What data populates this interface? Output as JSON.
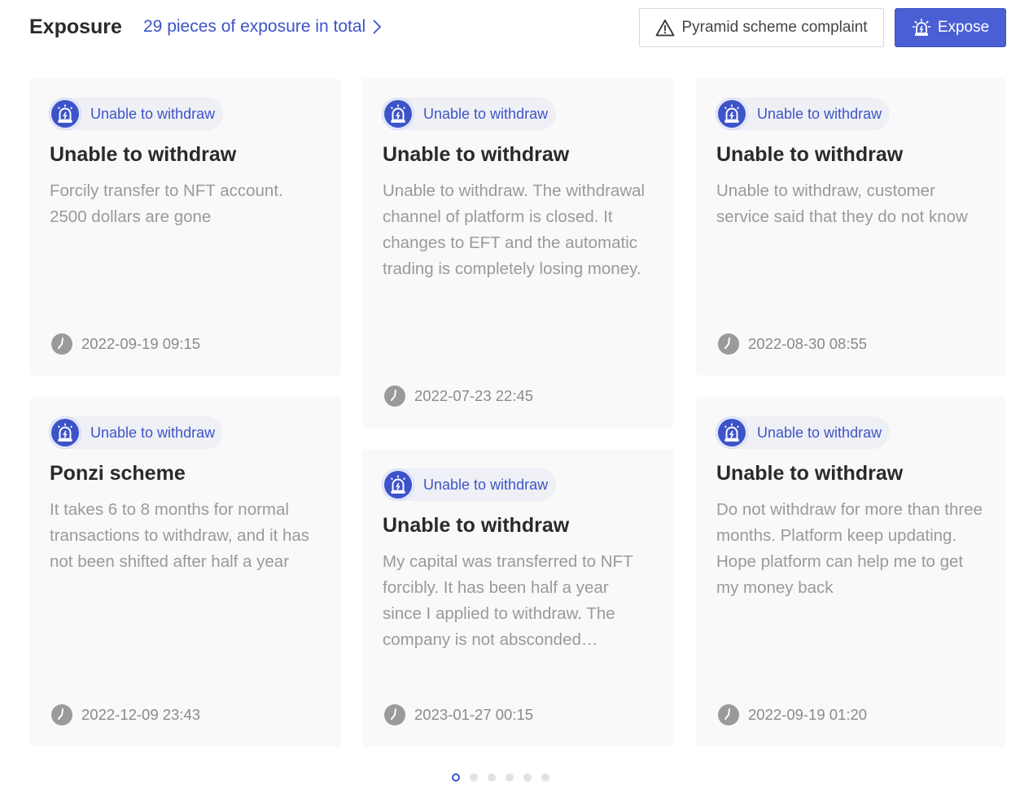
{
  "header": {
    "title": "Exposure",
    "total_link": "29 pieces of exposure in total",
    "complaint_button": "Pyramid scheme complaint",
    "expose_button": "Expose"
  },
  "colors": {
    "accent": "#4a5fd4",
    "link": "#3d54c8",
    "tag_bg": "#eff0f6",
    "card_bg": "#f9f9f9"
  },
  "cards": [
    {
      "tag": "Unable to withdraw",
      "title": "Unable to withdraw",
      "description": "Forcily transfer to NFT account. 2500 dollars are gone",
      "time": "2022-09-19 09:15"
    },
    {
      "tag": "Unable to withdraw",
      "title": "Unable to withdraw",
      "description": "Unable to withdraw. The withdrawal channel of platform is closed. It changes to EFT and the automatic trading is completely losing money.",
      "time": "2022-07-23 22:45"
    },
    {
      "tag": "Unable to withdraw",
      "title": "Unable to withdraw",
      "description": "Unable to withdraw, customer service said that they do not know",
      "time": "2022-08-30 08:55"
    },
    {
      "tag": "Unable to withdraw",
      "title": "Ponzi scheme",
      "description": "It takes 6 to 8 months for normal transactions to withdraw, and it has not been shifted after half a year",
      "time": "2022-12-09 23:43"
    },
    {
      "tag": "Unable to withdraw",
      "title": "Unable to withdraw",
      "description": "My capital was transferred to NFT forcibly. It has been half a year since I applied to withdraw. The company is not absconded…",
      "time": "2023-01-27 00:15"
    },
    {
      "tag": "Unable to withdraw",
      "title": "Unable to withdraw",
      "description": "Do not withdraw for more than three months. Platform keep updating. Hope platform can help me to get my money back",
      "time": "2022-09-19 01:20"
    }
  ],
  "pagination": {
    "pages": 6,
    "active": 1
  }
}
